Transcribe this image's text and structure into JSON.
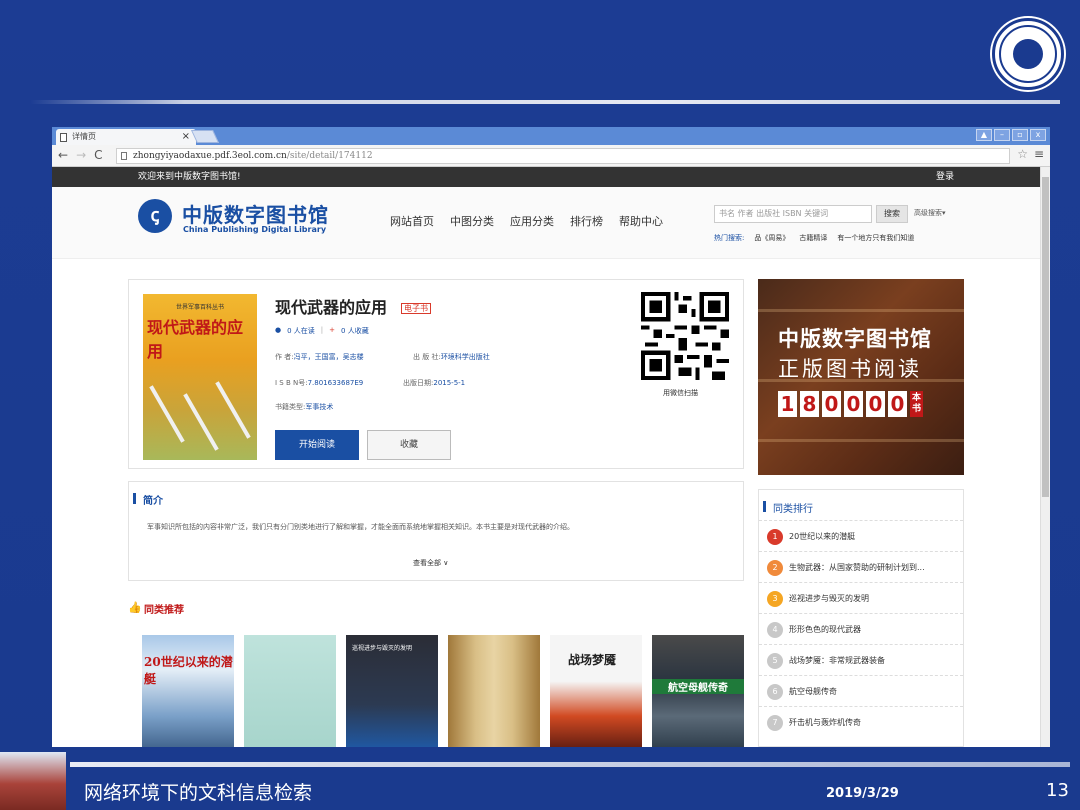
{
  "browser": {
    "tab_title": "详情页",
    "url_host": "zhongyiyaodaxue.pdf.3eol.com.cn",
    "url_path": "/site/detail/174112"
  },
  "site": {
    "welcome": "欢迎来到中版数字图书馆!",
    "login": "登录",
    "brand_cn": "中版数字图书馆",
    "brand_en": "China Publishing Digital Library",
    "nav": [
      "网站首页",
      "中图分类",
      "应用分类",
      "排行榜",
      "帮助中心"
    ],
    "search_placeholder": "书名 作者 出版社 ISBN 关键词",
    "search_button": "搜索",
    "advanced_search": "高级搜索",
    "hot_label": "热门搜索:",
    "hot_terms": [
      "品《周易》",
      "古籍精译",
      "有一个地方只有我们知道"
    ]
  },
  "book": {
    "cover_series": "世界军事百科丛书",
    "cover_title": "现代武器的应用",
    "title": "现代武器的应用",
    "tag": "电子书",
    "reading": "0 人在读",
    "favorites": "0 人收藏",
    "authors_label": "作 者:",
    "authors": "冯平，王国富，吴志楼",
    "publisher_label": "出 版 社:",
    "publisher": "环境科学出版社",
    "isbn_label": "I S B N号:",
    "isbn": "7.801633687E9",
    "pubdate_label": "出版日期:",
    "pubdate": "2015-5-1",
    "category_label": "书籍类型:",
    "category": "军事技术",
    "read_button": "开始阅读",
    "fav_button": "收藏",
    "qr_label": "用微信扫描"
  },
  "banner": {
    "line1": "中版数字图书馆",
    "line2": "正版图书阅读",
    "digits": [
      "1",
      "8",
      "0",
      "0",
      "0",
      "0"
    ],
    "unit": "本书"
  },
  "intro": {
    "title": "简介",
    "text": "军事知识所包括的内容非常广泛，我们只有分门别类地进行了解和掌握，才能全面而系统地掌握相关知识。本书主要是对现代武器的介绍。",
    "more": "查看全部"
  },
  "ranking": {
    "title": "同类排行",
    "items": [
      "20世纪以来的潜艇",
      "生物武器：从国家赞助的研制计划到...",
      "巡视进步与毁灭的发明",
      "形形色色的现代武器",
      "战场梦魇：非常规武器装备",
      "航空母舰传奇",
      "歼击机与轰炸机传奇"
    ]
  },
  "recommend": {
    "title": "同类推荐",
    "covers": [
      {
        "label": "20世纪以来的潜艇"
      },
      {
        "label": ""
      },
      {
        "label": "巡视进步与毁灭的发明"
      },
      {
        "label": ""
      },
      {
        "label": "战场梦魇"
      },
      {
        "label": "航空母舰传奇"
      }
    ]
  },
  "slide": {
    "title": "网络环境下的文科信息检索",
    "date": "2019/3/29",
    "page": "13"
  },
  "colors": {
    "slide_bg": "#1a3a8f",
    "brand_blue": "#1a4fa3",
    "accent_red": "#c01818",
    "rank_top": [
      "#d93a2b",
      "#f08a3b",
      "#f5a623"
    ]
  }
}
